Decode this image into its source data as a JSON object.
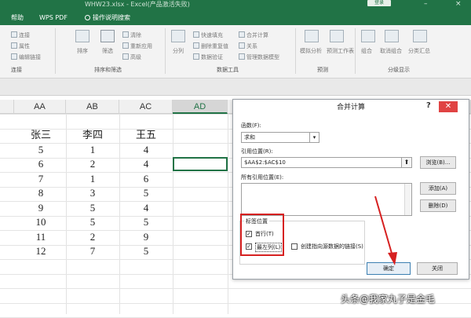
{
  "window": {
    "title": "WHW23.xlsx - Excel(产品激活失败)",
    "login": "登录"
  },
  "ribbon_tabs": {
    "help": "帮助",
    "wps_pdf": "WPS PDF",
    "search": "操作说明搜索"
  },
  "ribbon": {
    "connections": {
      "items": [
        "连接",
        "属性",
        "编辑链接"
      ],
      "group": "连接"
    },
    "sort_filter": {
      "sort_label": "排序",
      "filter_label": "筛选",
      "items": [
        "清除",
        "重新应用",
        "高级"
      ],
      "group": "排序和筛选"
    },
    "data_tools": {
      "split": "分列",
      "items": [
        "快速填充",
        "删除重复值",
        "数据验证",
        "合并计算",
        "关系",
        "管理数据模型"
      ],
      "group": "数据工具"
    },
    "forecast": {
      "whatif": "模拟分析",
      "sheet": "预测工作表",
      "group": "预测"
    },
    "outline": {
      "items": [
        "组合",
        "取消组合",
        "分类汇总"
      ],
      "group": "分级显示"
    }
  },
  "sheet": {
    "columns": [
      "AA",
      "AB",
      "AC",
      "AD"
    ],
    "active_column": "AD",
    "rows": [
      [
        "张三",
        "李四",
        "王五"
      ],
      [
        "5",
        "1",
        "4"
      ],
      [
        "6",
        "2",
        "4"
      ],
      [
        "7",
        "1",
        "6"
      ],
      [
        "8",
        "3",
        "5"
      ],
      [
        "9",
        "5",
        "4"
      ],
      [
        "10",
        "5",
        "5"
      ],
      [
        "11",
        "2",
        "9"
      ],
      [
        "12",
        "7",
        "5"
      ]
    ]
  },
  "dialog": {
    "title": "合并计算",
    "help": "?",
    "close": "✕",
    "function_label": "函数(F):",
    "function_value": "求和",
    "reference_label": "引用位置(R):",
    "reference_value": "$AA$2:$AC$10",
    "browse": "浏览(B)...",
    "all_refs_label": "所有引用位置(E):",
    "add": "添加(A)",
    "delete": "删除(D)",
    "label_group": "标签位置",
    "top_row": "首行(T)",
    "left_column": "最左列(L)",
    "top_row_checked": true,
    "left_column_checked": true,
    "link_source": "创建指向源数据的链接(S)",
    "link_source_checked": false,
    "ok": "确定",
    "close_button": "关闭"
  },
  "watermark": "头条@我家丸子是金毛",
  "colors": {
    "excel_green": "#217346",
    "highlight_red": "#d62020"
  }
}
